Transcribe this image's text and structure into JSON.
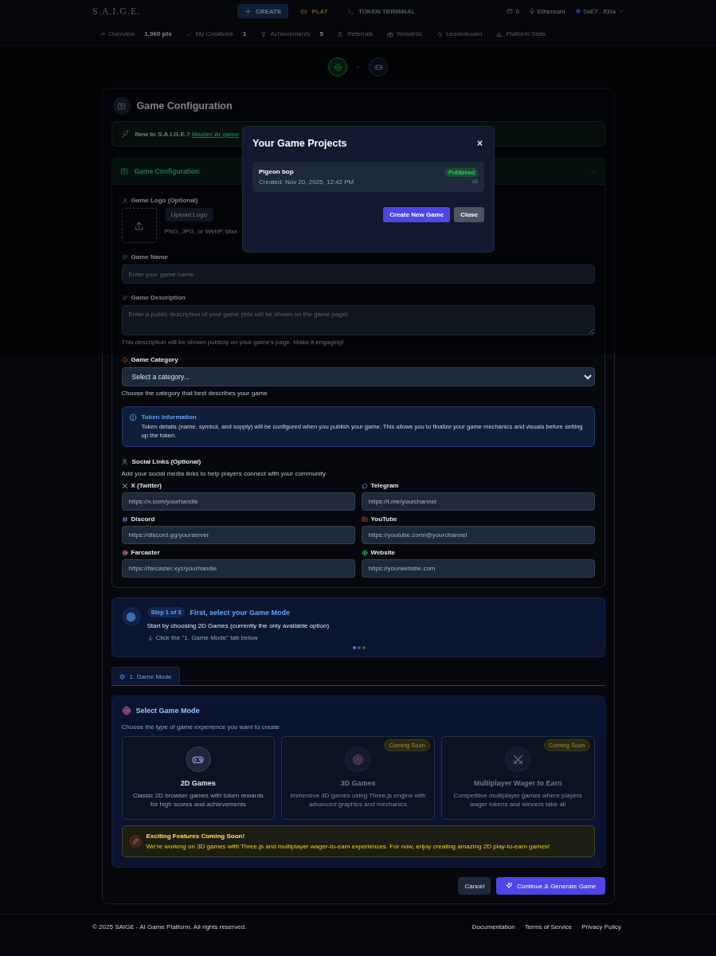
{
  "nav": {
    "logo": "S.A.I.G.E.",
    "tabs": [
      {
        "label": "CREATE",
        "selected": true
      },
      {
        "label": "PLAY",
        "selected": false
      },
      {
        "label": "TOKEN TERMINAL",
        "selected": false
      }
    ],
    "balance": "0",
    "network": "Ethereum",
    "wallet": "0xE7...f00a"
  },
  "subnav": [
    {
      "label": "Overview",
      "count": "1,960 pts"
    },
    {
      "label": "My Creations",
      "count": "1"
    },
    {
      "label": "Achievements",
      "count": "5"
    },
    {
      "label": "Referrals"
    },
    {
      "label": "Rewards"
    },
    {
      "label": "Leaderboard"
    },
    {
      "label": "Platform Stats"
    }
  ],
  "stepper": [
    {
      "kind": "settings",
      "selected": true
    },
    {
      "kind": "game",
      "selected": false
    }
  ],
  "page_title": "Game Configuration",
  "banner": {
    "text": "New to S.A.I.G.E.?",
    "link": "Master AI game"
  },
  "section": {
    "title": "Game Configuration",
    "expanded": true
  },
  "logo_field": {
    "label": "Game Logo (Optional)",
    "button": "Upload Logo",
    "hint": "PNG, JPG, or WebP. Max"
  },
  "name_field": {
    "label": "Game Name",
    "placeholder": "Enter your game name"
  },
  "description_field": {
    "label": "Game Description",
    "placeholder": "Enter a public description of your game (this will be shown on the game page)",
    "hint": "This description will be shown publicly on your game's page. Make it engaging!"
  },
  "category_field": {
    "label": "Game Category",
    "value": "Select a category...",
    "hint": "Choose the category that best describes your game"
  },
  "token_info": {
    "title": "Token Information",
    "text": "Token details (name, symbol, and supply) will be configured when you publish your game. This allows you to finalize your game mechanics and visuals before setting up the token."
  },
  "social": {
    "title": "Social Links (Optional)",
    "subtitle": "Add your social media links to help players connect with your community",
    "links": [
      {
        "kind": "x",
        "label": "X (Twitter)",
        "placeholder": "https://x.com/yourhandle"
      },
      {
        "kind": "telegram",
        "label": "Telegram",
        "placeholder": "https://t.me/yourchannel"
      },
      {
        "kind": "discord",
        "label": "Discord",
        "placeholder": "https://discord.gg/yourserver"
      },
      {
        "kind": "youtube",
        "label": "YouTube",
        "placeholder": "https://youtube.com/@yourchannel"
      },
      {
        "kind": "farcaster",
        "label": "Farcaster",
        "placeholder": "https://farcaster.xyz/yourhandle"
      },
      {
        "kind": "website",
        "label": "Website",
        "placeholder": "https://yourwebsite.com"
      }
    ]
  },
  "guide": {
    "badge": "Step 1 of 3",
    "title": "First, select your Game Mode",
    "text": "Start by choosing 2D Games (currently the only available option)",
    "hint": "Click the \"1. Game Mode\" tab below",
    "dots": [
      {
        "selected": true
      },
      {
        "selected": false
      },
      {
        "selected": false
      }
    ]
  },
  "tabs": [
    {
      "label": "1. Game Mode",
      "selected": true
    }
  ],
  "mode_panel": {
    "title": "Select Game Mode",
    "subtitle": "Choose the type of game experience you want to create",
    "modes": [
      {
        "kind": "classic",
        "title": "2D Games",
        "description": "Classic 2D browser games with token rewards for high scores and achievements",
        "disabled": false
      },
      {
        "kind": "immersive",
        "title": "3D Games",
        "description": "Immersive 3D games using Three.js engine with advanced graphics and mechanics",
        "badge": "Coming Soon",
        "disabled": true
      },
      {
        "kind": "multiplayer",
        "title": "Multiplayer Wager to Earn",
        "description": "Competitive multiplayer games where players wager tokens and winners take all",
        "badge": "Coming Soon",
        "disabled": true
      }
    ],
    "notice": {
      "title": "Exciting Features Coming Soon!",
      "text": "We're working on 3D games with Three.js and multiplayer wager-to-earn experiences. For now, enjoy creating amazing 2D play-to-earn games!"
    }
  },
  "actions": [
    {
      "kind": "secondary",
      "label": "Cancel"
    },
    {
      "kind": "primary",
      "label": "Continue & Generate Game"
    }
  ],
  "footer": {
    "copyright": "© 2025 SAIGE - AI Game Platform. All rights reserved.",
    "links": [
      "Documentation",
      "Terms of Service",
      "Privacy Policy"
    ]
  },
  "modal": {
    "title": "Your Game Projects",
    "close": "×",
    "projects": [
      {
        "name": "Pigeon bop",
        "created": "Created: Nov 20, 2025, 12:42 PM",
        "status": "Published",
        "version": "v8"
      }
    ],
    "buttons": [
      {
        "kind": "primary",
        "label": "Create New Game"
      },
      {
        "kind": "secondary",
        "label": "Close"
      }
    ]
  }
}
